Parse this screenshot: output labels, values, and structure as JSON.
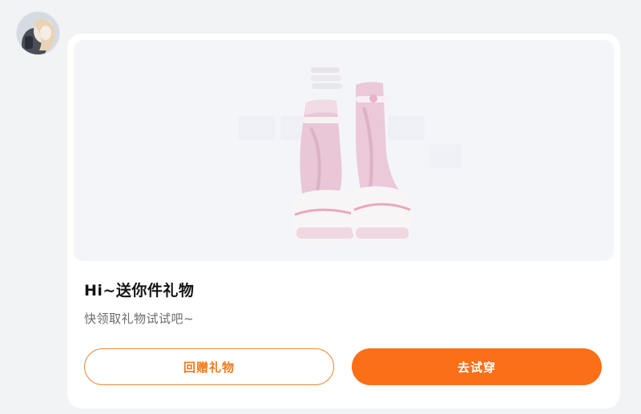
{
  "avatar": {
    "icon": "user-avatar"
  },
  "gift_card": {
    "image": {
      "icon": "pink-leg-warmers-boots-icon"
    },
    "title": "Hi~送你件礼物",
    "subtitle": "快领取礼物试试吧~",
    "buttons": {
      "return_gift_label": "回赠礼物",
      "try_on_label": "去试穿"
    }
  },
  "colors": {
    "accent": "#fb6f16",
    "page_background": "#f2f3f5",
    "card_background": "#ffffff"
  }
}
